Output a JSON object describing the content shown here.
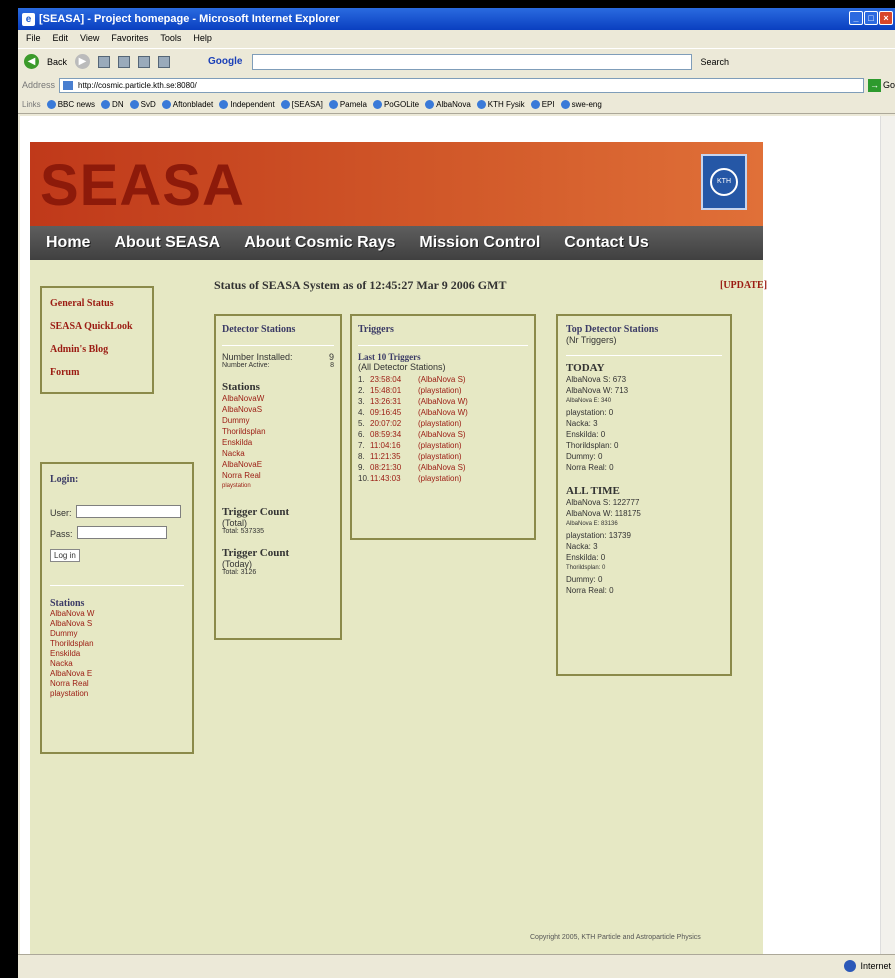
{
  "browser": {
    "title": "[SEASA] - Project homepage - Microsoft Internet Explorer",
    "menu": [
      "File",
      "Edit",
      "View",
      "Favorites",
      "Tools",
      "Help"
    ],
    "toolbar": {
      "back_label": "Back",
      "google_label": "Google",
      "search_label": "Search"
    },
    "address": {
      "label": "Address",
      "url": "http://cosmic.particle.kth.se:8080/",
      "go_label": "Go"
    },
    "links": {
      "label": "Links",
      "items": [
        "BBC news",
        "DN",
        "SvD",
        "Aftonbladet",
        "Independent",
        "[SEASA]",
        "Pamela",
        "PoGOLite",
        "AlbaNova",
        "KTH Fysik",
        "EPI",
        "swe-eng"
      ]
    },
    "status": {
      "zone": "Internet"
    }
  },
  "page": {
    "banner_title": "SEASA",
    "crest_text": "KTH",
    "nav": [
      "Home",
      "About SEASA",
      "About Cosmic Rays",
      "Mission Control",
      "Contact Us"
    ],
    "quick_links": [
      "General Status",
      "SEASA QuickLook",
      "Admin's Blog",
      "Forum"
    ],
    "status_heading": "Status of SEASA System as of 12:45:27 Mar 9 2006 GMT",
    "update_label": "[UPDATE]",
    "login": {
      "title": "Login:",
      "user_label": "User:",
      "pass_label": "Pass:",
      "button": "Log in",
      "stations_title": "Stations",
      "stations": [
        "AlbaNova W",
        "AlbaNova S",
        "Dummy",
        "Thorildsplan",
        "Enskilda",
        "Nacka",
        "AlbaNova E",
        "Norra Real",
        "playstation"
      ]
    },
    "detector": {
      "title": "Detector Stations",
      "installed_label": "Number Installed:",
      "installed_value": "9",
      "active_label": "Number Active:",
      "active_value": "8",
      "stations_title": "Stations",
      "stations": [
        "AlbaNovaW",
        "AlbaNovaS",
        "Dummy",
        "Thorildsplan",
        "Enskilda",
        "Nacka",
        "AlbaNovaE",
        "Norra Real",
        "playstation"
      ],
      "trigger_total_title": "Trigger Count",
      "trigger_total_sub": "(Total)",
      "trigger_total_value": "Total: 537335",
      "trigger_today_title": "Trigger Count",
      "trigger_today_sub": "(Today)",
      "trigger_today_value": "Total: 3126"
    },
    "triggers": {
      "title": "Triggers",
      "last_title": "Last 10 Triggers",
      "last_sub": "(All Detector Stations)",
      "rows": [
        {
          "n": "1.",
          "time": "23:58:04",
          "station": "(AlbaNova S)"
        },
        {
          "n": "2.",
          "time": "15:48:01",
          "station": "(playstation)"
        },
        {
          "n": "3.",
          "time": "13:26:31",
          "station": "(AlbaNova W)"
        },
        {
          "n": "4.",
          "time": "09:16:45",
          "station": "(AlbaNova W)"
        },
        {
          "n": "5.",
          "time": "20:07:02",
          "station": "(playstation)"
        },
        {
          "n": "6.",
          "time": "08:59:34",
          "station": "(AlbaNova S)"
        },
        {
          "n": "7.",
          "time": "11:04:16",
          "station": "(playstation)"
        },
        {
          "n": "8.",
          "time": "11:21:35",
          "station": "(playstation)"
        },
        {
          "n": "9.",
          "time": "08:21:30",
          "station": "(AlbaNova S)"
        },
        {
          "n": "10.",
          "time": "11:43:03",
          "station": "(playstation)"
        }
      ]
    },
    "top": {
      "title": "Top Detector Stations",
      "sub": "(Nr Triggers)",
      "today_title": "TODAY",
      "today": [
        {
          "name": "AlbaNova S:",
          "value": "673"
        },
        {
          "name": "AlbaNova W:",
          "value": "713"
        },
        {
          "name": "AlbaNova E:",
          "value": "340"
        },
        {
          "name": "playstation:",
          "value": "0"
        },
        {
          "name": "Nacka:",
          "value": "3"
        },
        {
          "name": "Enskilda:",
          "value": "0"
        },
        {
          "name": "Thorildsplan:",
          "value": "0"
        },
        {
          "name": "Dummy:",
          "value": "0"
        },
        {
          "name": "Norra Real:",
          "value": "0"
        }
      ],
      "alltime_title": "ALL TIME",
      "alltime": [
        {
          "name": "AlbaNova S:",
          "value": "122777"
        },
        {
          "name": "AlbaNova W:",
          "value": "118175"
        },
        {
          "name": "AlbaNova E:",
          "value": "83136"
        },
        {
          "name": "playstation:",
          "value": "13739"
        },
        {
          "name": "Nacka:",
          "value": "3"
        },
        {
          "name": "Enskilda:",
          "value": "0"
        },
        {
          "name": "Thorildsplan:",
          "value": "0"
        },
        {
          "name": "Dummy:",
          "value": "0"
        },
        {
          "name": "Norra Real:",
          "value": "0"
        }
      ]
    },
    "copyright": "Copyright 2005, KTH Particle and Astroparticle Physics"
  }
}
